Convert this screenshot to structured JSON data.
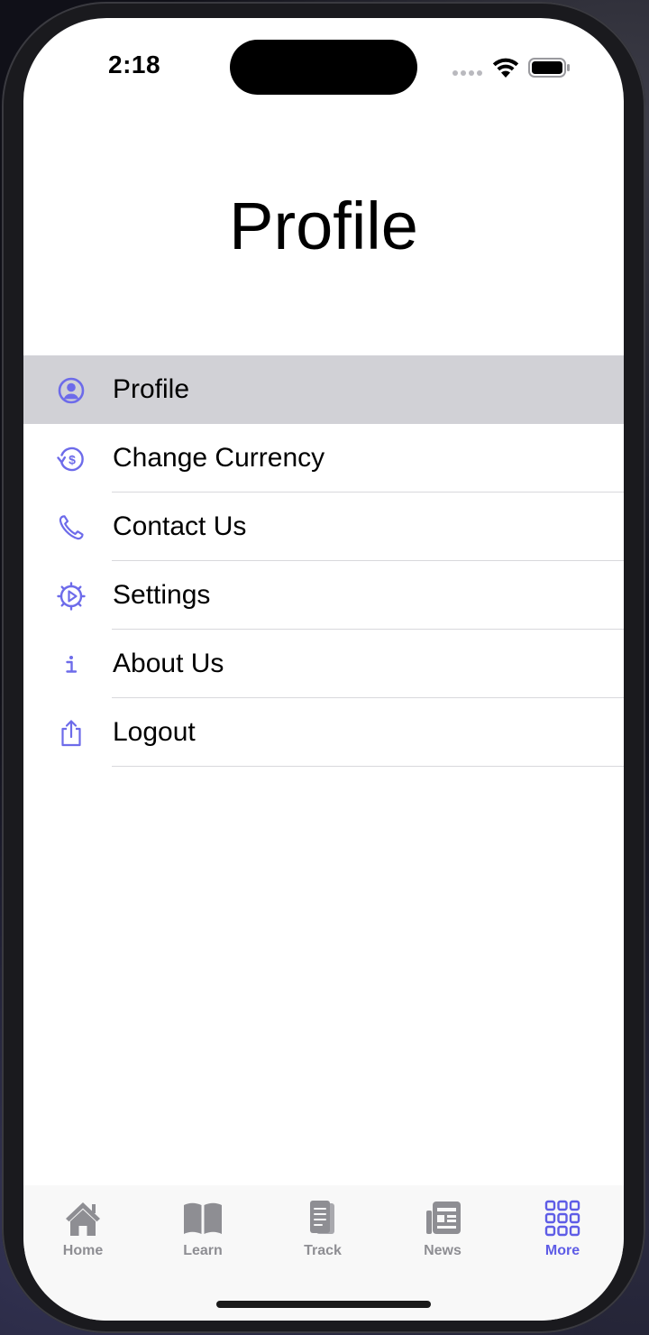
{
  "status_bar": {
    "time": "2:18"
  },
  "page": {
    "title": "Profile"
  },
  "menu": {
    "items": [
      {
        "label": "Profile",
        "icon": "profile-circle-icon",
        "selected": true
      },
      {
        "label": "Change Currency",
        "icon": "currency-exchange-icon",
        "selected": false
      },
      {
        "label": "Contact Us",
        "icon": "phone-icon",
        "selected": false
      },
      {
        "label": "Settings",
        "icon": "gear-icon",
        "selected": false
      },
      {
        "label": "About Us",
        "icon": "info-icon",
        "selected": false
      },
      {
        "label": "Logout",
        "icon": "share-upload-icon",
        "selected": false
      }
    ]
  },
  "tab_bar": {
    "tabs": [
      {
        "label": "Home",
        "icon": "home-icon",
        "active": false
      },
      {
        "label": "Learn",
        "icon": "book-icon",
        "active": false
      },
      {
        "label": "Track",
        "icon": "document-icon",
        "active": false
      },
      {
        "label": "News",
        "icon": "newspaper-icon",
        "active": false
      },
      {
        "label": "More",
        "icon": "grid-icon",
        "active": true
      }
    ]
  },
  "colors": {
    "accent": "#5e5ce6",
    "selected_row": "#d1d1d6",
    "inactive_tab": "#8e8e93",
    "icon_accent": "#6d6bea"
  }
}
